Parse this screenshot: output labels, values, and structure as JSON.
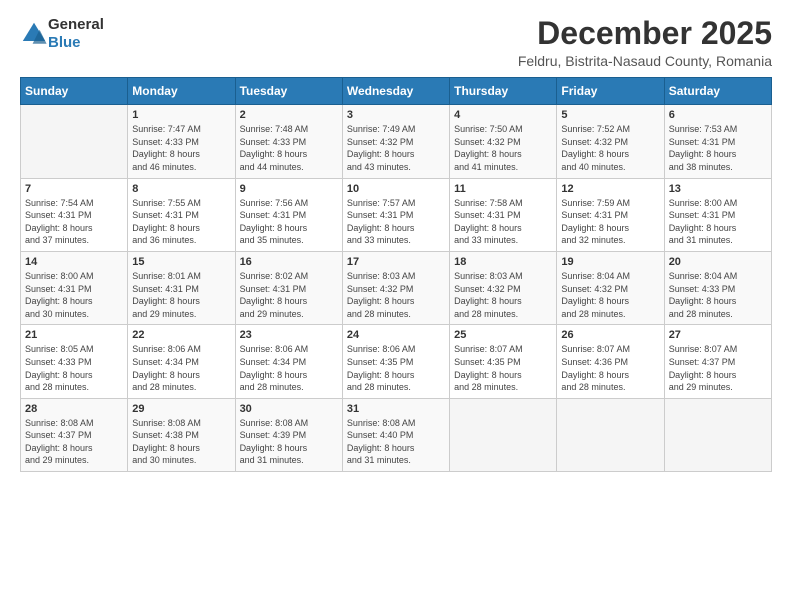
{
  "header": {
    "logo_general": "General",
    "logo_blue": "Blue",
    "title": "December 2025",
    "subtitle": "Feldru, Bistrita-Nasaud County, Romania"
  },
  "days_of_week": [
    "Sunday",
    "Monday",
    "Tuesday",
    "Wednesday",
    "Thursday",
    "Friday",
    "Saturday"
  ],
  "weeks": [
    [
      {
        "day": "",
        "info": ""
      },
      {
        "day": "1",
        "info": "Sunrise: 7:47 AM\nSunset: 4:33 PM\nDaylight: 8 hours\nand 46 minutes."
      },
      {
        "day": "2",
        "info": "Sunrise: 7:48 AM\nSunset: 4:33 PM\nDaylight: 8 hours\nand 44 minutes."
      },
      {
        "day": "3",
        "info": "Sunrise: 7:49 AM\nSunset: 4:32 PM\nDaylight: 8 hours\nand 43 minutes."
      },
      {
        "day": "4",
        "info": "Sunrise: 7:50 AM\nSunset: 4:32 PM\nDaylight: 8 hours\nand 41 minutes."
      },
      {
        "day": "5",
        "info": "Sunrise: 7:52 AM\nSunset: 4:32 PM\nDaylight: 8 hours\nand 40 minutes."
      },
      {
        "day": "6",
        "info": "Sunrise: 7:53 AM\nSunset: 4:31 PM\nDaylight: 8 hours\nand 38 minutes."
      }
    ],
    [
      {
        "day": "7",
        "info": "Sunrise: 7:54 AM\nSunset: 4:31 PM\nDaylight: 8 hours\nand 37 minutes."
      },
      {
        "day": "8",
        "info": "Sunrise: 7:55 AM\nSunset: 4:31 PM\nDaylight: 8 hours\nand 36 minutes."
      },
      {
        "day": "9",
        "info": "Sunrise: 7:56 AM\nSunset: 4:31 PM\nDaylight: 8 hours\nand 35 minutes."
      },
      {
        "day": "10",
        "info": "Sunrise: 7:57 AM\nSunset: 4:31 PM\nDaylight: 8 hours\nand 33 minutes."
      },
      {
        "day": "11",
        "info": "Sunrise: 7:58 AM\nSunset: 4:31 PM\nDaylight: 8 hours\nand 33 minutes."
      },
      {
        "day": "12",
        "info": "Sunrise: 7:59 AM\nSunset: 4:31 PM\nDaylight: 8 hours\nand 32 minutes."
      },
      {
        "day": "13",
        "info": "Sunrise: 8:00 AM\nSunset: 4:31 PM\nDaylight: 8 hours\nand 31 minutes."
      }
    ],
    [
      {
        "day": "14",
        "info": "Sunrise: 8:00 AM\nSunset: 4:31 PM\nDaylight: 8 hours\nand 30 minutes."
      },
      {
        "day": "15",
        "info": "Sunrise: 8:01 AM\nSunset: 4:31 PM\nDaylight: 8 hours\nand 29 minutes."
      },
      {
        "day": "16",
        "info": "Sunrise: 8:02 AM\nSunset: 4:31 PM\nDaylight: 8 hours\nand 29 minutes."
      },
      {
        "day": "17",
        "info": "Sunrise: 8:03 AM\nSunset: 4:32 PM\nDaylight: 8 hours\nand 28 minutes."
      },
      {
        "day": "18",
        "info": "Sunrise: 8:03 AM\nSunset: 4:32 PM\nDaylight: 8 hours\nand 28 minutes."
      },
      {
        "day": "19",
        "info": "Sunrise: 8:04 AM\nSunset: 4:32 PM\nDaylight: 8 hours\nand 28 minutes."
      },
      {
        "day": "20",
        "info": "Sunrise: 8:04 AM\nSunset: 4:33 PM\nDaylight: 8 hours\nand 28 minutes."
      }
    ],
    [
      {
        "day": "21",
        "info": "Sunrise: 8:05 AM\nSunset: 4:33 PM\nDaylight: 8 hours\nand 28 minutes."
      },
      {
        "day": "22",
        "info": "Sunrise: 8:06 AM\nSunset: 4:34 PM\nDaylight: 8 hours\nand 28 minutes."
      },
      {
        "day": "23",
        "info": "Sunrise: 8:06 AM\nSunset: 4:34 PM\nDaylight: 8 hours\nand 28 minutes."
      },
      {
        "day": "24",
        "info": "Sunrise: 8:06 AM\nSunset: 4:35 PM\nDaylight: 8 hours\nand 28 minutes."
      },
      {
        "day": "25",
        "info": "Sunrise: 8:07 AM\nSunset: 4:35 PM\nDaylight: 8 hours\nand 28 minutes."
      },
      {
        "day": "26",
        "info": "Sunrise: 8:07 AM\nSunset: 4:36 PM\nDaylight: 8 hours\nand 28 minutes."
      },
      {
        "day": "27",
        "info": "Sunrise: 8:07 AM\nSunset: 4:37 PM\nDaylight: 8 hours\nand 29 minutes."
      }
    ],
    [
      {
        "day": "28",
        "info": "Sunrise: 8:08 AM\nSunset: 4:37 PM\nDaylight: 8 hours\nand 29 minutes."
      },
      {
        "day": "29",
        "info": "Sunrise: 8:08 AM\nSunset: 4:38 PM\nDaylight: 8 hours\nand 30 minutes."
      },
      {
        "day": "30",
        "info": "Sunrise: 8:08 AM\nSunset: 4:39 PM\nDaylight: 8 hours\nand 31 minutes."
      },
      {
        "day": "31",
        "info": "Sunrise: 8:08 AM\nSunset: 4:40 PM\nDaylight: 8 hours\nand 31 minutes."
      },
      {
        "day": "",
        "info": ""
      },
      {
        "day": "",
        "info": ""
      },
      {
        "day": "",
        "info": ""
      }
    ]
  ]
}
